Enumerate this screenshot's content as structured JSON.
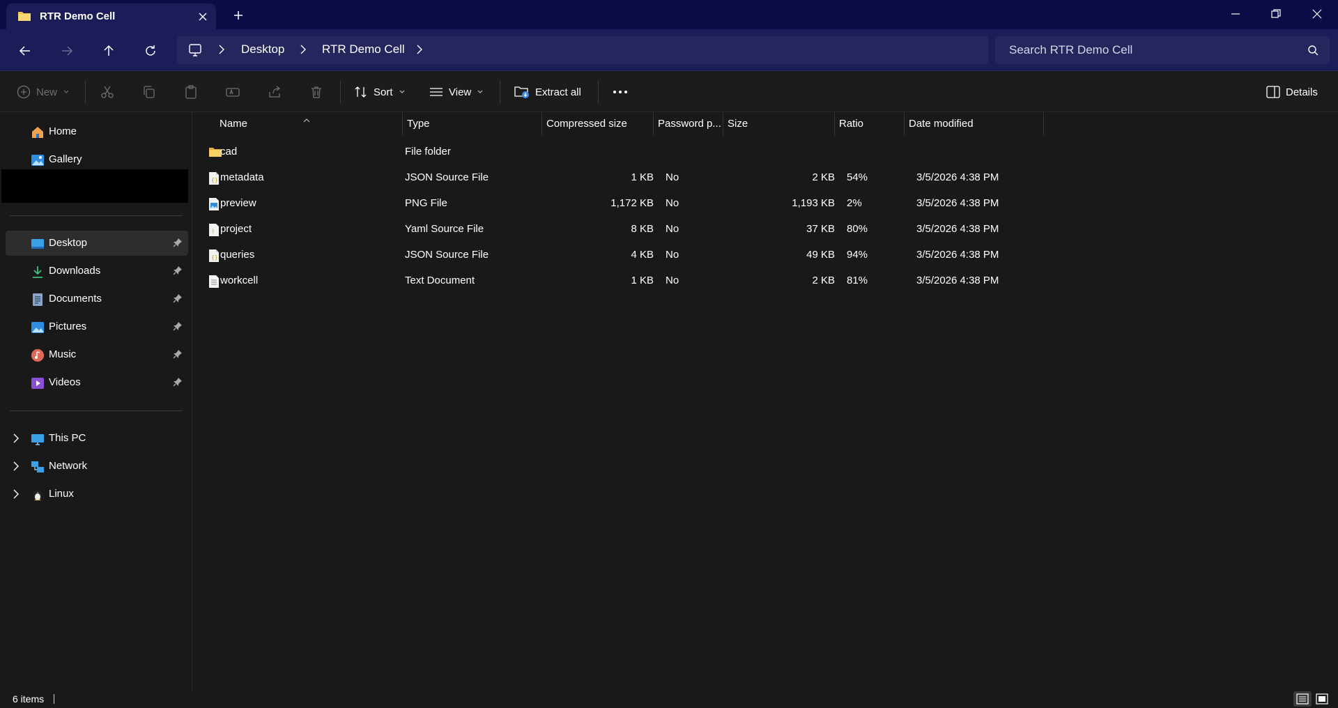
{
  "window": {
    "tab_title": "RTR Demo Cell"
  },
  "address": {
    "crumbs": [
      "Desktop",
      "RTR Demo Cell"
    ]
  },
  "search": {
    "placeholder": "Search RTR Demo Cell"
  },
  "toolbar": {
    "new_label": "New",
    "sort_label": "Sort",
    "view_label": "View",
    "extract_label": "Extract all",
    "details_label": "Details"
  },
  "sidebar": {
    "quick": [
      {
        "label": "Home",
        "icon": "home-icon"
      },
      {
        "label": "Gallery",
        "icon": "gallery-icon"
      }
    ],
    "pinned": [
      {
        "label": "Desktop",
        "icon": "desktop-icon"
      },
      {
        "label": "Downloads",
        "icon": "downloads-icon"
      },
      {
        "label": "Documents",
        "icon": "documents-icon"
      },
      {
        "label": "Pictures",
        "icon": "pictures-icon"
      },
      {
        "label": "Music",
        "icon": "music-icon"
      },
      {
        "label": "Videos",
        "icon": "videos-icon"
      }
    ],
    "locations": [
      {
        "label": "This PC",
        "icon": "this-pc-icon"
      },
      {
        "label": "Network",
        "icon": "network-icon"
      },
      {
        "label": "Linux",
        "icon": "linux-icon"
      }
    ]
  },
  "columns": {
    "name": "Name",
    "type": "Type",
    "compressed": "Compressed size",
    "password": "Password p...",
    "size": "Size",
    "ratio": "Ratio",
    "modified": "Date modified"
  },
  "files": [
    {
      "name": "cad",
      "type": "File folder",
      "compressed": "",
      "password": "",
      "size": "",
      "ratio": "",
      "modified": "",
      "icon": "folder-icon"
    },
    {
      "name": "metadata",
      "type": "JSON Source File",
      "compressed": "1 KB",
      "password": "No",
      "size": "2 KB",
      "ratio": "54%",
      "modified": "3/5/2026 4:38 PM",
      "icon": "json-file-icon"
    },
    {
      "name": "preview",
      "type": "PNG File",
      "compressed": "1,172 KB",
      "password": "No",
      "size": "1,193 KB",
      "ratio": "2%",
      "modified": "3/5/2026 4:38 PM",
      "icon": "png-file-icon"
    },
    {
      "name": "project",
      "type": "Yaml Source File",
      "compressed": "8 KB",
      "password": "No",
      "size": "37 KB",
      "ratio": "80%",
      "modified": "3/5/2026 4:38 PM",
      "icon": "yaml-file-icon"
    },
    {
      "name": "queries",
      "type": "JSON Source File",
      "compressed": "4 KB",
      "password": "No",
      "size": "49 KB",
      "ratio": "94%",
      "modified": "3/5/2026 4:38 PM",
      "icon": "json-file-icon"
    },
    {
      "name": "workcell",
      "type": "Text Document",
      "compressed": "1 KB",
      "password": "No",
      "size": "2 KB",
      "ratio": "81%",
      "modified": "3/5/2026 4:38 PM",
      "icon": "text-file-icon"
    }
  ],
  "status": {
    "items": "6 items"
  },
  "colors": {
    "titlebar": "#0b0b45",
    "navbar": "#1c1c58",
    "background": "#191919"
  }
}
